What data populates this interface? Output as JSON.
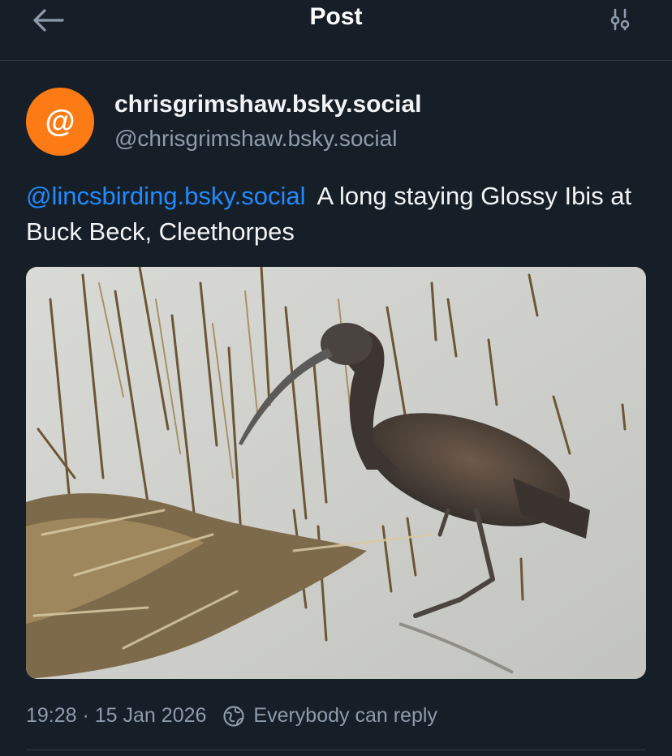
{
  "header": {
    "title": "Post",
    "back_icon": "arrow-left-icon",
    "settings_icon": "sliders-icon"
  },
  "author": {
    "avatar_glyph": "@",
    "avatar_color": "#fd7b14",
    "display_name": "chrisgrimshaw.bsky.social",
    "handle": "@chrisgrimshaw.bsky.social"
  },
  "post": {
    "mention": "@lincsbirding.bsky.social",
    "text": "A long staying Glossy Ibis at Buck Beck, Cleethorpes",
    "image_subject": "glossy-ibis-photo"
  },
  "meta": {
    "timestamp": "19:28 · 15 Jan 2026",
    "reply_setting": "Everybody can reply",
    "reply_icon": "globe-icon"
  },
  "colors": {
    "background": "#161e27",
    "link": "#208bfe",
    "muted": "#8d9bab"
  }
}
